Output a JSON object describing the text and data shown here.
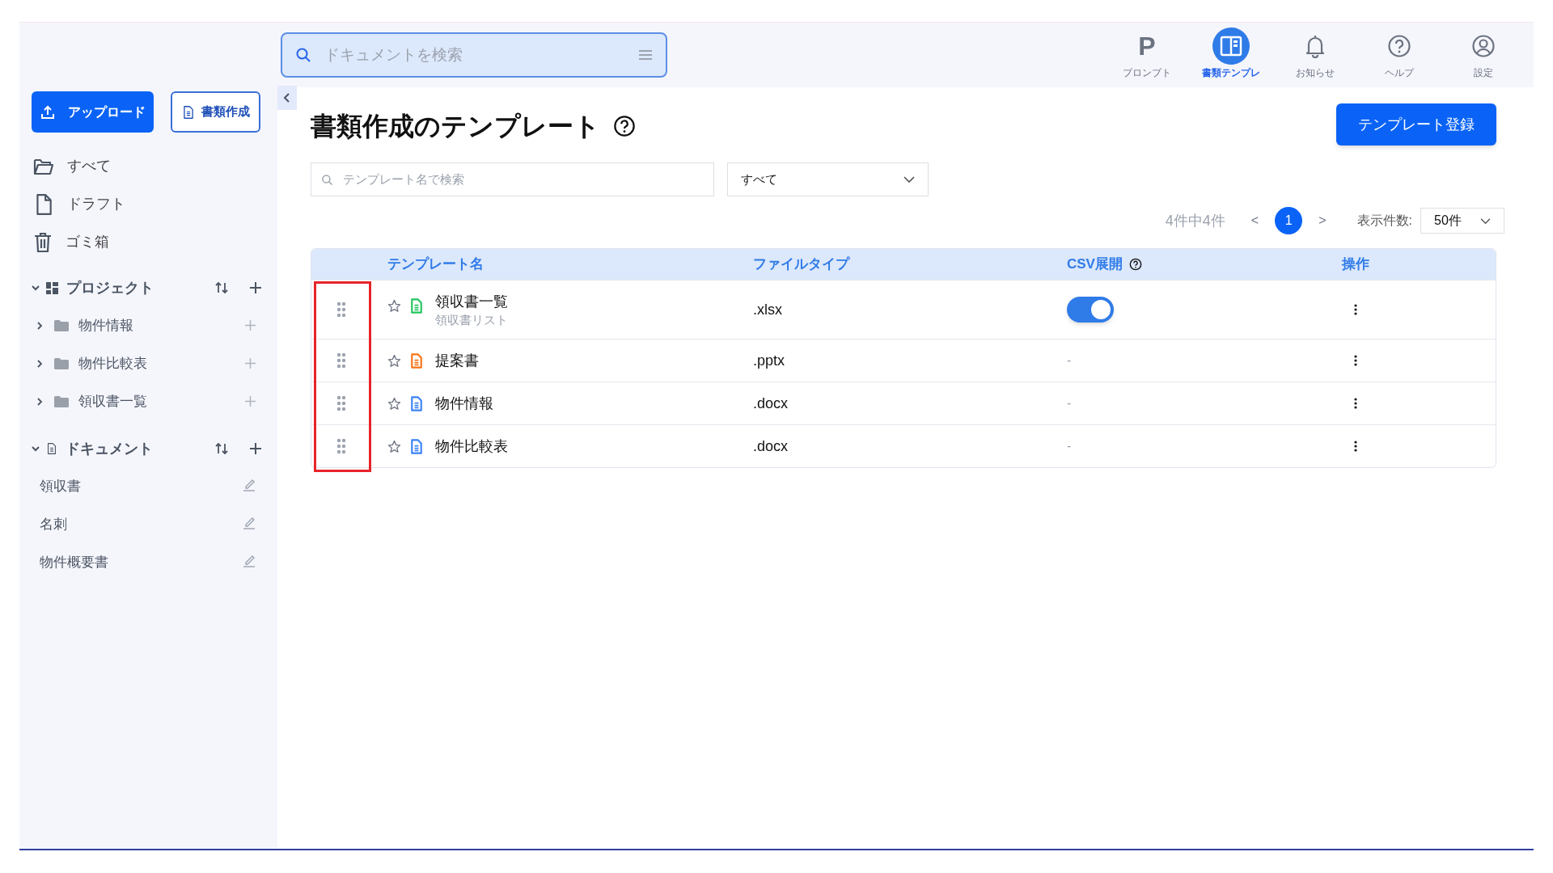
{
  "search": {
    "placeholder": "ドキュメントを検索"
  },
  "nav": [
    {
      "kind": "prompt",
      "glyph": "P",
      "label": "プロンプト",
      "selected": false
    },
    {
      "kind": "template",
      "label": "書類テンプレ",
      "selected": true
    },
    {
      "kind": "bell",
      "label": "お知らせ",
      "selected": false
    },
    {
      "kind": "help",
      "label": "ヘルプ",
      "selected": false
    },
    {
      "kind": "user",
      "label": "設定",
      "selected": false
    }
  ],
  "sidebar": {
    "upload_button": "アップロード",
    "create_button": "書類作成",
    "items": [
      {
        "kind": "folder",
        "label": "すべて"
      },
      {
        "kind": "file",
        "label": "ドラフト"
      },
      {
        "kind": "trash",
        "label": "ゴミ箱"
      }
    ],
    "sections": [
      {
        "kind": "project",
        "title": "プロジェクト",
        "expanded": true,
        "children": [
          {
            "label": "物件情報",
            "expanded": false
          },
          {
            "label": "物件比較表",
            "expanded": false
          },
          {
            "label": "領収書一覧",
            "expanded": false
          }
        ]
      },
      {
        "kind": "document",
        "title": "ドキュメント",
        "expanded": true,
        "children": [
          {
            "label": "領収書"
          },
          {
            "label": "名刺"
          },
          {
            "label": "物件概要書"
          }
        ]
      }
    ]
  },
  "page": {
    "title": "書類作成のテンプレート",
    "register_button": "テンプレート登録",
    "template_search": {
      "placeholder": "テンプレート名で検索"
    },
    "filter": "すべて",
    "count": "4件中4件",
    "prev": "<",
    "pages": [
      {
        "label": "1",
        "selected": true
      }
    ],
    "next": ">",
    "page_size_label": "表示件数:",
    "page_size": "50件"
  },
  "table": {
    "columns": [
      "テンプレート名",
      "ファイルタイプ",
      "CSV展開",
      "操作"
    ],
    "rows": [
      {
        "name": "領収書一覧",
        "subtitle": "領収書リスト",
        "starred": false,
        "color": "#22c55e",
        "file_type": ".xlsx",
        "csv": {
          "kind": "toggle",
          "on": true
        }
      },
      {
        "name": "提案書",
        "starred": false,
        "color": "#f97316",
        "file_type": ".pptx",
        "csv": {
          "kind": "text",
          "text": "-"
        }
      },
      {
        "name": "物件情報",
        "starred": false,
        "color": "#3b82f6",
        "file_type": ".docx",
        "csv": {
          "kind": "text",
          "text": "-"
        }
      },
      {
        "name": "物件比較表",
        "starred": false,
        "color": "#3b82f6",
        "file_type": ".docx",
        "csv": {
          "kind": "text",
          "text": "-"
        }
      }
    ]
  }
}
